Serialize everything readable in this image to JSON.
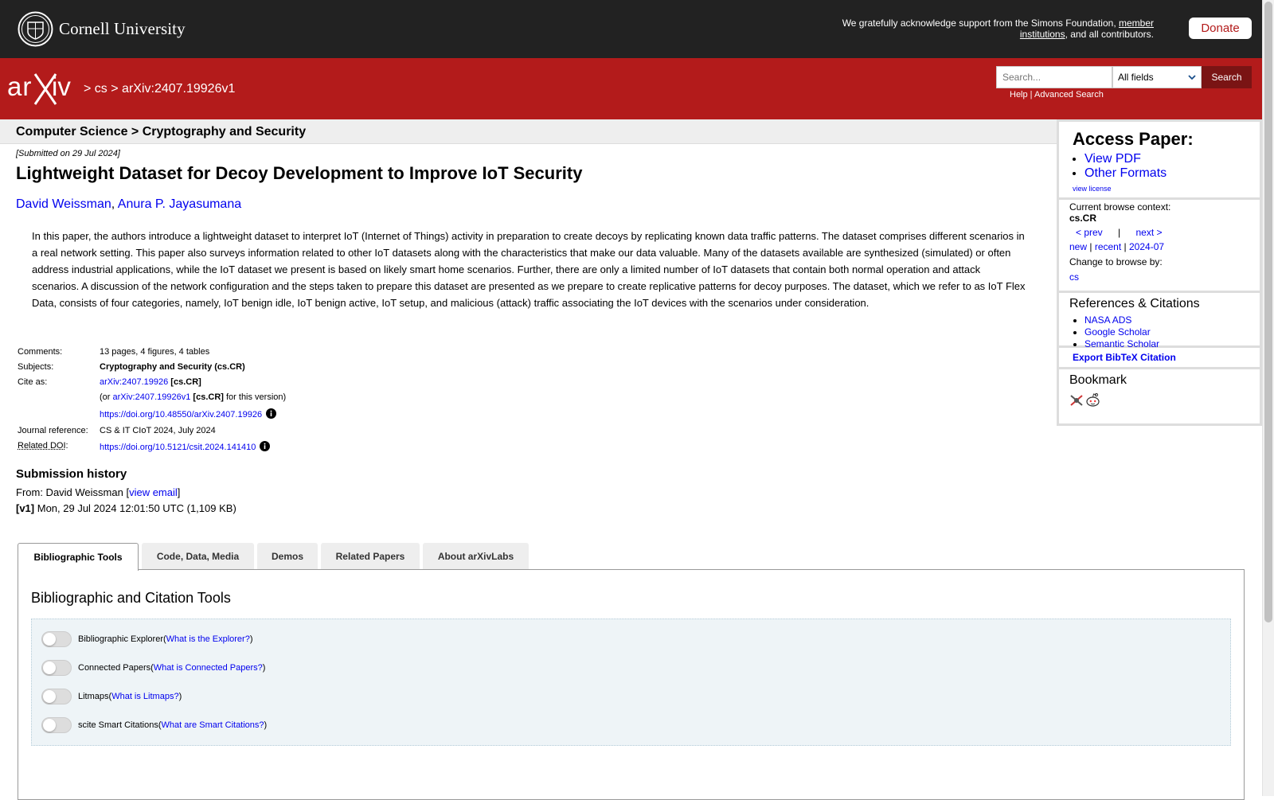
{
  "cornell": {
    "name": "Cornell University",
    "support_prefix": "We gratefully acknowledge support from the Simons Foundation, ",
    "support_link": "member institutions",
    "support_suffix": ", and all contributors.",
    "donate_label": "Donate"
  },
  "arxiv": {
    "logo_text": "arXiv",
    "crumb_sep": ">",
    "crumb_cs": "cs",
    "crumb_id": "arXiv:2407.19926v1",
    "search_placeholder": "Search...",
    "search_field": "All fields",
    "search_button": "Search",
    "help_label": "Help",
    "advanced_label": "Advanced Search",
    "help_sep": " | "
  },
  "subheader": "Computer Science > Cryptography and Security",
  "paper": {
    "submitted": "[Submitted on 29 Jul 2024]",
    "title": "Lightweight Dataset for Decoy Development to Improve IoT Security",
    "authors": [
      "David Weissman",
      "Anura P. Jayasumana"
    ],
    "author_sep": ", ",
    "abstract": "In this paper, the authors introduce a lightweight dataset to interpret IoT (Internet of Things) activity in preparation to create decoys by replicating known data traffic patterns. The dataset comprises different scenarios in a real network setting. This paper also surveys information related to other IoT datasets along with the characteristics that make our data valuable. Many of the datasets available are synthesized (simulated) or often address industrial applications, while the IoT dataset we present is based on likely smart home scenarios. Further, there are only a limited number of IoT datasets that contain both normal operation and attack scenarios. A discussion of the network configuration and the steps taken to prepare this dataset are presented as we prepare to create replicative patterns for decoy purposes. The dataset, which we refer to as IoT Flex Data, consists of four categories, namely, IoT benign idle, IoT benign active, IoT setup, and malicious (attack) traffic associating the IoT devices with the scenarios under consideration."
  },
  "meta": {
    "comments_label": "Comments:",
    "comments": "13 pages, 4 figures, 4 tables",
    "subjects_label": "Subjects:",
    "subjects": "Cryptography and Security (cs.CR)",
    "cite_label": "Cite as:",
    "cite_id": "arXiv:2407.19926",
    "cite_cat": "[cs.CR]",
    "cite_or": "(or ",
    "cite_v1": "arXiv:2407.19926v1",
    "cite_v1_cat": "[cs.CR]",
    "cite_v1_suffix": " for this version)",
    "doi": "https://doi.org/10.48550/arXiv.2407.19926",
    "journal_label": "Journal reference:",
    "journal": "CS & IT CIoT 2024, July 2024",
    "related_doi_abbr": "Related DOI",
    "related_doi_colon": ":",
    "related_doi": "https://doi.org/10.5121/csit.2024.141410"
  },
  "history": {
    "title": "Submission history",
    "from_prefix": "From: David Weissman [",
    "view_email": "view email",
    "from_suffix": "]",
    "v1_label": "[v1]",
    "v1_text": " Mon, 29 Jul 2024 12:01:50 UTC (1,109 KB)"
  },
  "tabs": [
    "Bibliographic Tools",
    "Code, Data, Media",
    "Demos",
    "Related Papers",
    "About arXivLabs"
  ],
  "tools": {
    "title": "Bibliographic and Citation Tools",
    "items": [
      {
        "label": "Bibliographic Explorer",
        "link": "What is the Explorer?"
      },
      {
        "label": "Connected Papers",
        "link": "What is Connected Papers?"
      },
      {
        "label": "Litmaps",
        "link": "What is Litmaps?"
      },
      {
        "label": "scite Smart Citations",
        "link": "What are Smart Citations?"
      }
    ],
    "open_paren": " (",
    "close_paren": ")"
  },
  "sidebar": {
    "access_title": "Access Paper:",
    "view_pdf": "View PDF",
    "other_formats": "Other Formats",
    "view_license": "view license",
    "context_label": "Current browse context:",
    "context": "cs.CR",
    "prev": "< prev",
    "nav_sep": "|",
    "next": "next >",
    "new": "new",
    "recent": "recent",
    "month": "2024-07",
    "change_label": "Change to browse by:",
    "change_cs": "cs",
    "refs_title": "References & Citations",
    "refs": [
      "NASA ADS",
      "Google Scholar",
      "Semantic Scholar"
    ],
    "export": "Export BibTeX Citation",
    "bookmark_title": "Bookmark"
  },
  "colors": {
    "cornell_bar": "#222222",
    "arxiv_red": "#b31b1b",
    "link": "#0000ee"
  }
}
